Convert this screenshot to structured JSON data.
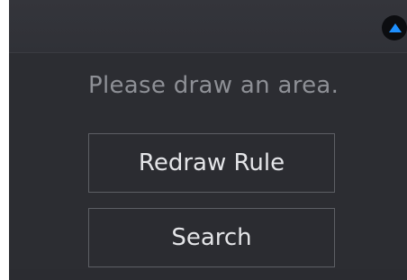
{
  "hint": {
    "text": "Please draw an area."
  },
  "buttons": {
    "redraw_label": "Redraw Rule",
    "search_label": "Search"
  },
  "toggle": {
    "icon": "triangle-up-icon",
    "color": "#1e90ff"
  }
}
